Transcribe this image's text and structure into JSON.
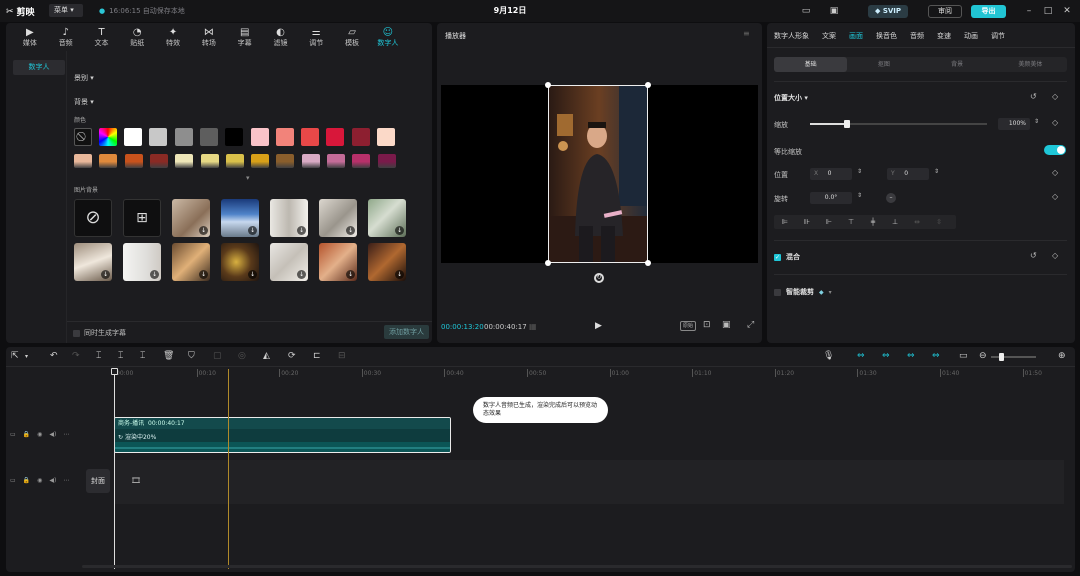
{
  "titlebar": {
    "app_name": "剪映",
    "menu_label": "菜单",
    "save_status": "16:06:15 自动保存本地",
    "project_title": "9月12日",
    "svip_label": "SVIP",
    "review_label": "审阅",
    "export_label": "导出"
  },
  "media": {
    "tabs": [
      {
        "label": "媒体",
        "icon": "media-icon"
      },
      {
        "label": "音频",
        "icon": "audio-icon"
      },
      {
        "label": "文本",
        "icon": "text-icon"
      },
      {
        "label": "贴纸",
        "icon": "sticker-icon"
      },
      {
        "label": "特效",
        "icon": "effects-icon"
      },
      {
        "label": "转场",
        "icon": "transition-icon"
      },
      {
        "label": "字幕",
        "icon": "subtitle-icon"
      },
      {
        "label": "滤镜",
        "icon": "filter-icon"
      },
      {
        "label": "调节",
        "icon": "adjust-icon"
      },
      {
        "label": "模板",
        "icon": "template-icon"
      },
      {
        "label": "数字人",
        "icon": "digital-human-icon"
      }
    ],
    "active_tab": "数字人",
    "side_item": "数字人",
    "section_appearance": "景别",
    "section_background": "背景",
    "color_label": "颜色",
    "image_bg_label": "图片背景",
    "colors_row1": [
      "#ffffff",
      "#c8c8c8",
      "#8e8e8e",
      "#5e5e5e",
      "#000000",
      "#f9c3c8",
      "#f2837a",
      "#e84848",
      "#d8173a",
      "#8d1f30",
      "#fbd9c8"
    ],
    "colors_row2": [
      "#e8b79a",
      "#e08a3c",
      "#c8521c",
      "#8a2a24",
      "#eee6b8",
      "#e6d884",
      "#d9c04a",
      "#d8a018",
      "#8a5e2c",
      "#d8aac4",
      "#c46c98",
      "#b8306a",
      "#7a1a4a"
    ],
    "footer_checkbox": "同时生成字幕",
    "add_button": "添加数字人"
  },
  "player": {
    "title": "播放器",
    "current_time": "00:00:13:20",
    "total_time": "00:00:40:17",
    "ratio_label": "原始"
  },
  "props": {
    "tabs": [
      "数字人形象",
      "文案",
      "画面",
      "换音色",
      "音频",
      "变速",
      "动画",
      "调节"
    ],
    "active_tab": "画面",
    "subtabs": [
      "基础",
      "抠图",
      "背景",
      "美颜美体"
    ],
    "active_subtab": "基础",
    "position_size": "位置大小",
    "scale_label": "缩放",
    "scale_value": "100%",
    "scale_fraction": 0.21,
    "uniform_scale": "等比缩放",
    "position_label": "位置",
    "pos_x_label": "X",
    "pos_x": "0",
    "pos_y_label": "Y",
    "pos_y": "0",
    "rotate_label": "旋转",
    "rotate_value": "0.0°",
    "blend_label": "混合",
    "smart_crop_label": "智能裁剪"
  },
  "timeline": {
    "ticks": [
      "00:00",
      "00:10",
      "00:20",
      "00:30",
      "00:40",
      "00:50",
      "01:00",
      "01:10",
      "01:20",
      "01:30",
      "01:40",
      "01:50"
    ],
    "clip_title": "商务-播讯",
    "clip_duration": "00:00:40:17",
    "clip_status": "渲染中20%",
    "tooltip": "数字人音频已生成，渲染完成后可以预览动态效果",
    "cover_label": "封面"
  }
}
